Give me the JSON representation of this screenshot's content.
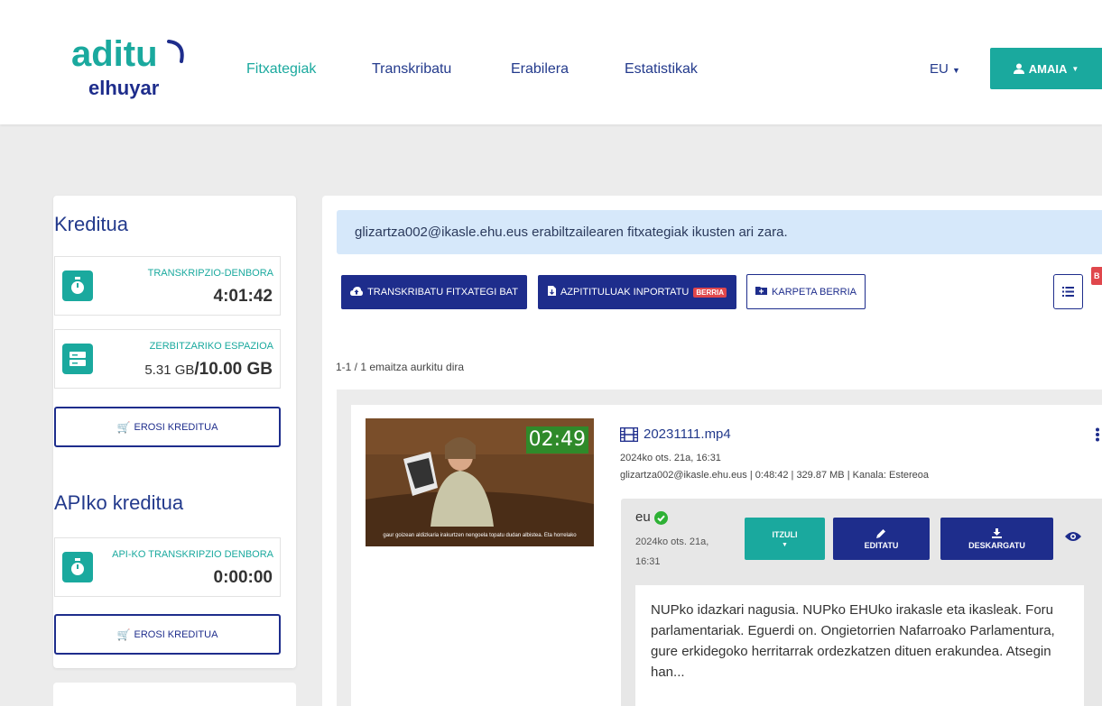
{
  "header": {
    "logo": {
      "main": "aditu",
      "sub": "elhuyar"
    },
    "nav": [
      "Fitxategiak",
      "Transkribatu",
      "Erabilera",
      "Estatistikak"
    ],
    "language": "EU",
    "user": "AMAIA"
  },
  "sidebar": {
    "credit_title": "Kreditua",
    "transcription_time": {
      "label": "TRANSKRIPZIO-DENBORA",
      "value": "4:01:42"
    },
    "storage": {
      "label": "ZERBITZARIKO ESPAZIOA",
      "used": "5.31 GB",
      "separator": "/",
      "total": "10.00 GB"
    },
    "buy_label": "EROSI KREDITUA",
    "api_title": "APIko kreditua",
    "api_time": {
      "label": "API-KO TRANSKRIPZIO DENBORA",
      "value": "0:00:00"
    },
    "api_buy_label": "EROSI KREDITUA"
  },
  "main": {
    "alert": "glizartza002@ikasle.ehu.eus erabiltzailearen fitxategiak ikusten ari zara.",
    "toolbar": {
      "transcribe": "TRANSKRIBATU FITXATEGI BAT",
      "import": "AZPITITULUAK INPORTATU",
      "new_badge": "BERRIA",
      "new_folder": "KARPETA BERRIA",
      "corner_badge": "B"
    },
    "result_count": "1-1 / 1 emaitza aurkitu dira",
    "file": {
      "video_time": "02:49",
      "video_subtitle": "gaur goizean aldizkaria irakurtzen nengoela topatu dudan albistea. Eta horrelako",
      "name": "20231111.mp4",
      "date": "2024ko ots. 21a, 16:31",
      "meta": "glizartza002@ikasle.ehu.eus | 0:48:42 | 329.87 MB | Kanala: Estereoa",
      "transcript": {
        "lang": "eu",
        "date_line1": "2024ko ots. 21a,",
        "date_line2": "16:31",
        "translate": "ITZULI",
        "edit": "EDITATU",
        "download": "DESKARGATU",
        "preview": "NUPko idazkari nagusia. NUPko EHUko irakasle eta ikasleak. Foru parlamentariak. Eguerdi on. Ongietorrien Nafarroako Parlamentura, gure erkidegoko herritarrak ordezkatzen dituen erakundea. Atsegin han..."
      }
    }
  },
  "colors": {
    "teal": "#1aa99e",
    "navy": "#1e2d8c",
    "red": "#e0474c",
    "alert_bg": "#d6e8fa"
  }
}
